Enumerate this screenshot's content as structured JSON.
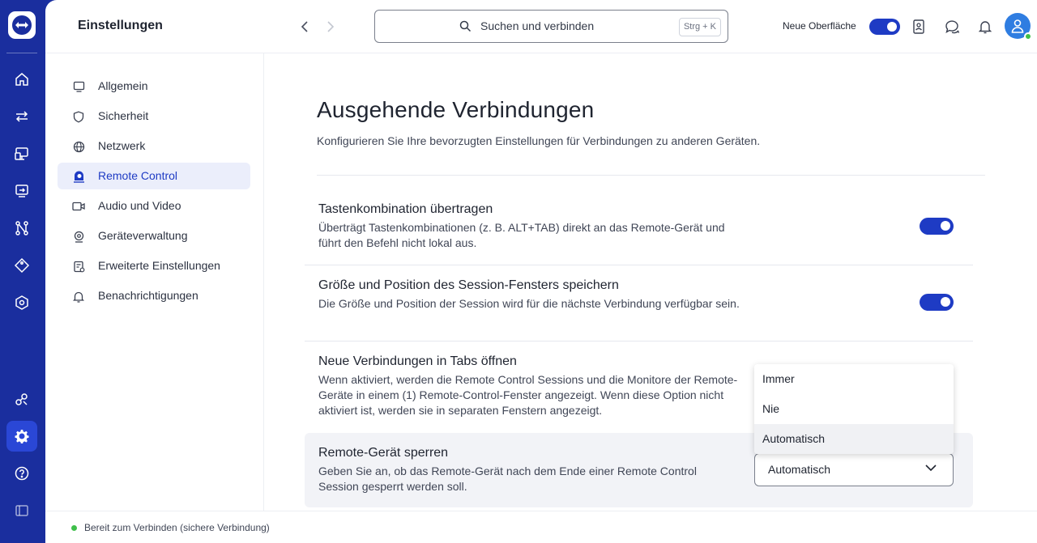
{
  "header": {
    "title": "Einstellungen",
    "search_placeholder": "Suchen und verbinden",
    "search_shortcut": "Strg + K",
    "new_ui_label": "Neue Oberfläche"
  },
  "rail": {
    "items": [
      "home-icon",
      "transfer-icon",
      "remote-device-icon",
      "session-icon",
      "flow-icon",
      "tag-icon",
      "security-icon",
      "integrations-icon",
      "settings-icon",
      "help-icon",
      "panel-icon"
    ],
    "active": "settings-icon"
  },
  "settings_nav": {
    "items": [
      {
        "label": "Allgemein",
        "icon": "monitor-icon"
      },
      {
        "label": "Sicherheit",
        "icon": "shield-icon"
      },
      {
        "label": "Netzwerk",
        "icon": "globe-icon"
      },
      {
        "label": "Remote Control",
        "icon": "remote-control-icon"
      },
      {
        "label": "Audio und Video",
        "icon": "camera-icon"
      },
      {
        "label": "Geräteverwaltung",
        "icon": "device-management-icon"
      },
      {
        "label": "Erweiterte Einstellungen",
        "icon": "advanced-settings-icon"
      },
      {
        "label": "Benachrichtigungen",
        "icon": "bell-icon"
      }
    ],
    "active_index": 3
  },
  "content": {
    "title": "Ausgehende Verbindungen",
    "subtitle": "Konfigurieren Sie Ihre bevorzugten Einstellungen für Verbindungen zu anderen Geräten.",
    "rows": [
      {
        "title": "Tastenkombination übertragen",
        "desc": "Überträgt Tastenkombinationen (z. B. ALT+TAB) direkt an das Remote-Gerät und führt den Befehl nicht lokal aus.",
        "enabled": true
      },
      {
        "title": "Größe und Position des Session-Fensters speichern",
        "desc": "Die Größe und Position der Session wird für die nächste Verbindung verfügbar sein.",
        "enabled": true
      },
      {
        "title": "Neue Verbindungen in Tabs öffnen",
        "desc": "Wenn aktiviert, werden die Remote Control Sessions und die Monitore der Remote-Geräte in einem (1) Remote-Control-Fenster angezeigt. Wenn diese Option nicht aktiviert ist, werden sie in separaten Fenstern angezeigt."
      },
      {
        "title": "Remote-Gerät sperren",
        "desc": "Geben Sie an, ob das Remote-Gerät nach dem Ende einer Remote Control Session gesperrt werden soll."
      }
    ],
    "lock_select": {
      "value": "Automatisch",
      "options": [
        "Immer",
        "Nie",
        "Automatisch"
      ]
    }
  },
  "status": {
    "text": "Bereit zum Verbinden (sichere Verbindung)"
  },
  "colors": {
    "rail": "#1a2e9e",
    "accent": "#1e3bc4",
    "online": "#3fbf4a"
  }
}
